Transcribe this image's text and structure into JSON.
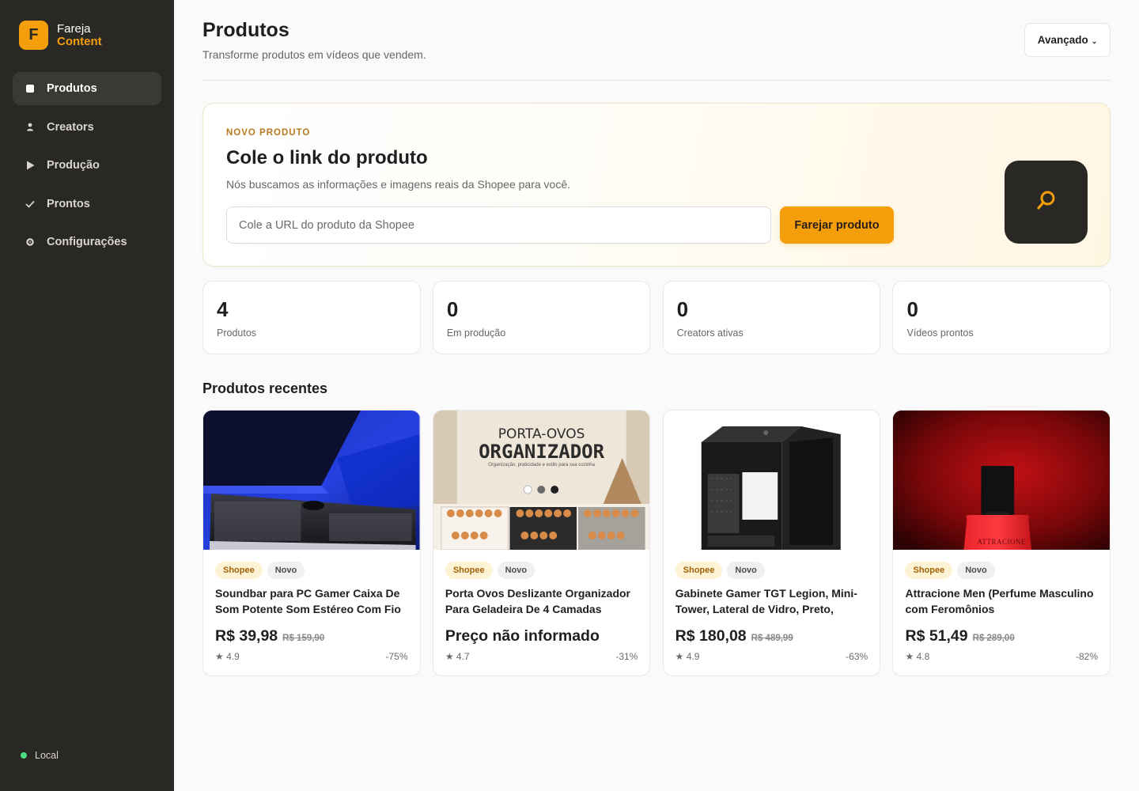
{
  "sidebar": {
    "brand_initial": "F",
    "brand_line1": "Fareja",
    "brand_line2": "Content",
    "items": [
      {
        "label": "Produtos",
        "icon": "square-icon",
        "active": true
      },
      {
        "label": "Creators",
        "icon": "person-icon",
        "active": false
      },
      {
        "label": "Produção",
        "icon": "play-icon",
        "active": false
      },
      {
        "label": "Prontos",
        "icon": "check-icon",
        "active": false
      },
      {
        "label": "Configurações",
        "icon": "gear-icon",
        "active": false
      }
    ],
    "status_label": "Local",
    "status_color": "#4ade80"
  },
  "header": {
    "title": "Produtos",
    "subtitle": "Transforme produtos em vídeos que vendem.",
    "advanced_label": "Avançado",
    "advanced_chevron": "⌄"
  },
  "hero": {
    "eyebrow": "NOVO PRODUTO",
    "title": "Cole o link do produto",
    "description": "Nós buscamos as informações e imagens reais da Shopee para você.",
    "input_placeholder": "Cole a URL do produto da Shopee",
    "input_value": "",
    "button_label": "Farejar produto",
    "icon": "search-icon"
  },
  "stats": [
    {
      "value": "4",
      "label": "Produtos"
    },
    {
      "value": "0",
      "label": "Em produção"
    },
    {
      "value": "0",
      "label": "Creators ativas"
    },
    {
      "value": "0",
      "label": "Vídeos prontos"
    }
  ],
  "recent": {
    "title": "Produtos recentes",
    "products": [
      {
        "store": "Shopee",
        "badge": "Novo",
        "title": "Soundbar para PC Gamer Caixa De Som Potente Som Estéreo Com Fio",
        "price": "R$ 39,98",
        "old_price": "R$ 159,90",
        "rating": "★ 4.9",
        "discount": "-75%",
        "image": "soundbar-image"
      },
      {
        "store": "Shopee",
        "badge": "Novo",
        "title": "Porta Ovos Deslizante Organizador Para Geladeira De 4 Camadas",
        "price": "Preço não informado",
        "old_price": "",
        "rating": "★ 4.7",
        "discount": "-31%",
        "image": "egg-organizer-image",
        "image_text_1": "PORTA-OVOS",
        "image_text_2": "ORGANIZADOR",
        "image_text_3": "Organização, praticidade e estilo para sua cozinha"
      },
      {
        "store": "Shopee",
        "badge": "Novo",
        "title": "Gabinete Gamer TGT Legion, Mini-Tower, Lateral de Vidro, Preto,",
        "price": "R$ 180,08",
        "old_price": "R$ 489,99",
        "rating": "★ 4.9",
        "discount": "-63%",
        "image": "pc-case-image"
      },
      {
        "store": "Shopee",
        "badge": "Novo",
        "title": "Attracione Men (Perfume Masculino com Feromônios",
        "price": "R$ 51,49",
        "old_price": "R$ 289,00",
        "rating": "★ 4.8",
        "discount": "-82%",
        "image": "perfume-image",
        "image_text_1": "ATTRACIONE"
      }
    ]
  },
  "colors": {
    "accent": "#f59e0b",
    "sidebar_bg": "#2a2824",
    "page_bg": "#fafafa"
  }
}
